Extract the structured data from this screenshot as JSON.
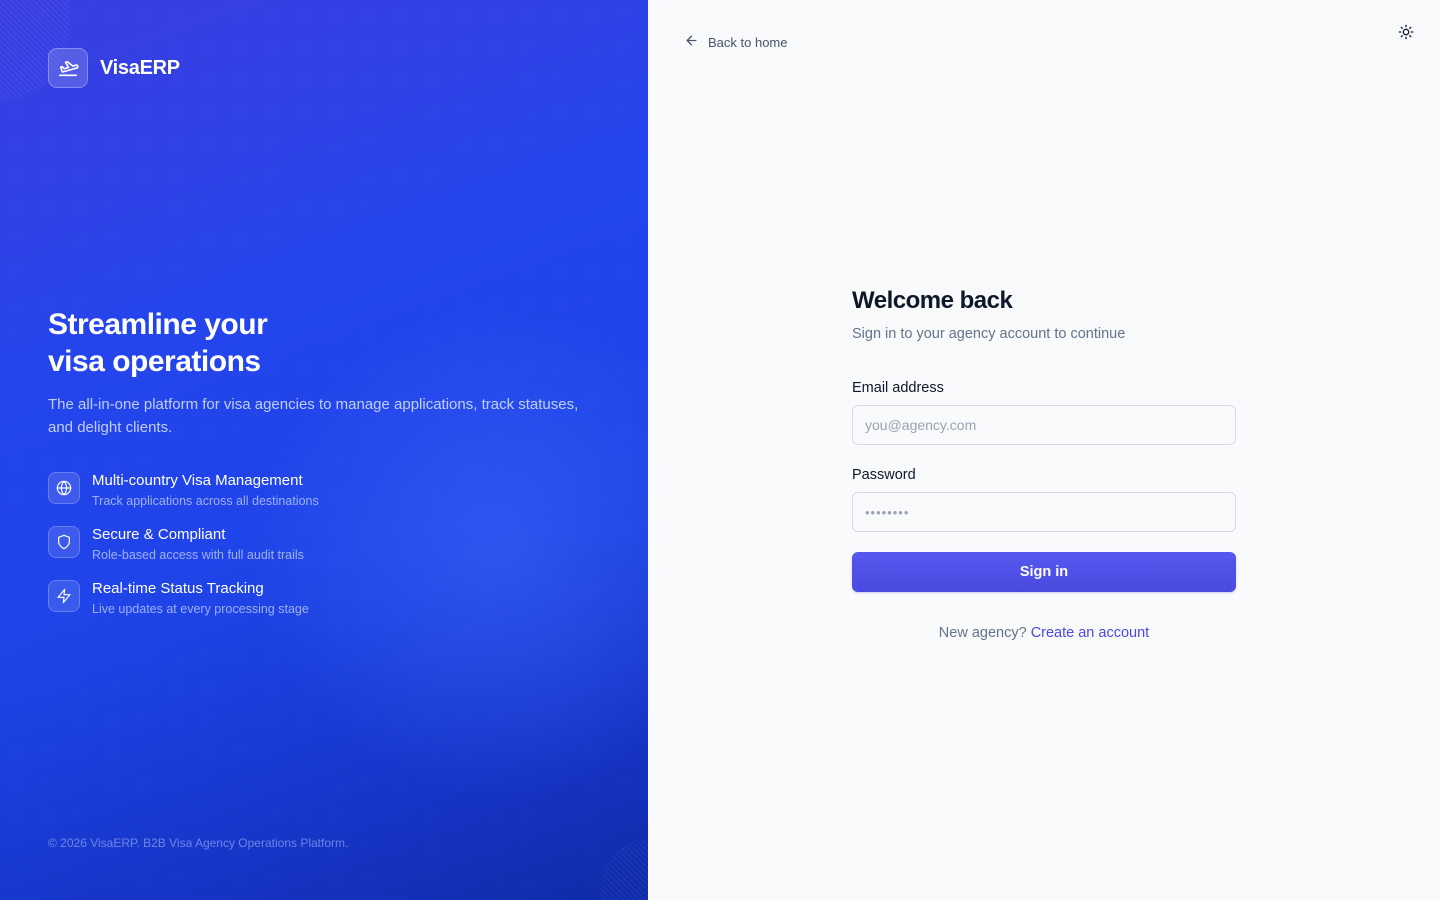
{
  "brand": {
    "name": "VisaERP"
  },
  "hero": {
    "headline_line1": "Streamline your",
    "headline_line2": "visa operations",
    "description": "The all-in-one platform for visa agencies to manage applications, track statuses, and delight clients.",
    "features": [
      {
        "icon": "globe-icon",
        "title": "Multi-country Visa Management",
        "description": "Track applications across all destinations"
      },
      {
        "icon": "shield-icon",
        "title": "Secure & Compliant",
        "description": "Role-based access with full audit trails"
      },
      {
        "icon": "lightning-icon",
        "title": "Real-time Status Tracking",
        "description": "Live updates at every processing stage"
      }
    ],
    "copyright": "© 2026 VisaERP. B2B Visa Agency Operations Platform."
  },
  "nav": {
    "back_label": "Back to home",
    "theme_toggle_icon": "sun-icon"
  },
  "form": {
    "title": "Welcome back",
    "subtitle": "Sign in to your agency account to continue",
    "email_label": "Email address",
    "email_placeholder": "you@agency.com",
    "email_value": "",
    "password_label": "Password",
    "password_placeholder": "••••••••",
    "password_value": "",
    "submit_label": "Sign in",
    "signup_prompt": "New agency?",
    "signup_link": "Create an account"
  },
  "colors": {
    "hero_gradient_start": "#3b3ee0",
    "hero_gradient_end": "#0f2ba8",
    "primary_button": "#4f46e5",
    "link": "#4f46e5",
    "page_background": "#f8fafc"
  }
}
